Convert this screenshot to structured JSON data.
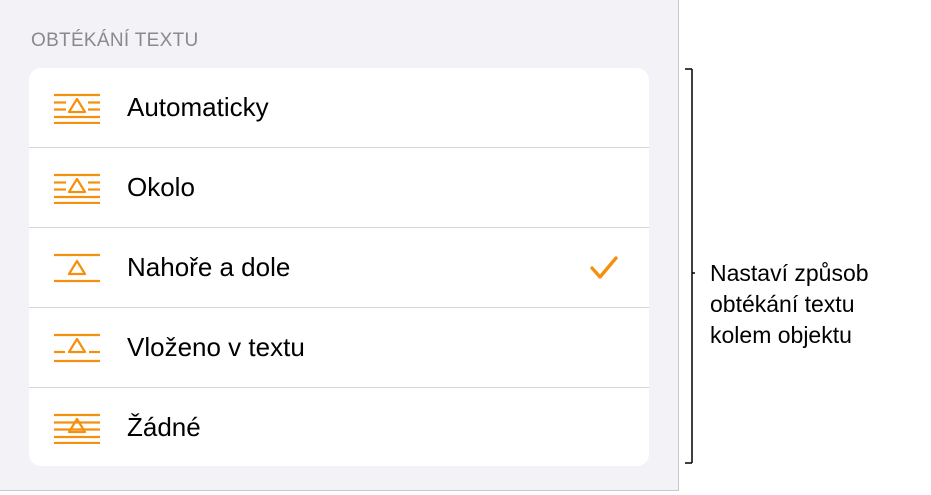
{
  "section": {
    "header": "OBTÉKÁNÍ TEXTU"
  },
  "options": [
    {
      "label": "Automaticky",
      "icon": "wrap-automatic-icon",
      "selected": false
    },
    {
      "label": "Okolo",
      "icon": "wrap-around-icon",
      "selected": false
    },
    {
      "label": "Nahoře a dole",
      "icon": "wrap-above-below-icon",
      "selected": true
    },
    {
      "label": "Vloženo v textu",
      "icon": "wrap-inline-icon",
      "selected": false
    },
    {
      "label": "Žádné",
      "icon": "wrap-none-icon",
      "selected": false
    }
  ],
  "callout": {
    "lines": [
      "Nastaví způsob",
      "obtékání textu",
      "kolem objektu"
    ]
  },
  "colors": {
    "accent": "#f5900f",
    "panel_bg": "#f2f2f7",
    "header_text": "#8a8a8e"
  }
}
